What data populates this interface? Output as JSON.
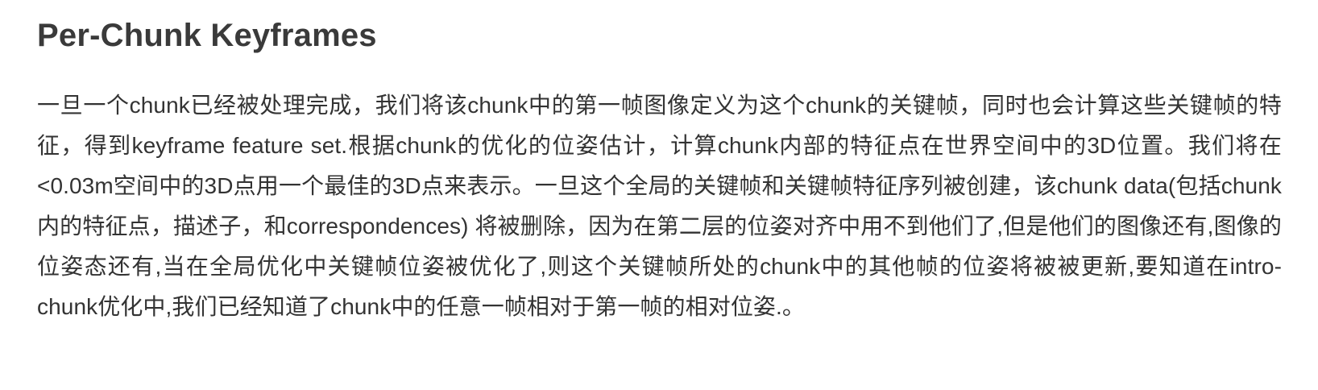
{
  "heading": "Per-Chunk Keyframes",
  "paragraph": "一旦一个chunk已经被处理完成，我们将该chunk中的第一帧图像定义为这个chunk的关键帧，同时也会计算这些关键帧的特征，得到keyframe feature set.根据chunk的优化的位姿估计，计算chunk内部的特征点在世界空间中的3D位置。我们将在<0.03m空间中的3D点用一个最佳的3D点来表示。一旦这个全局的关键帧和关键帧特征序列被创建，该chunk data(包括chunk内的特征点，描述子，和correspondences) 将被删除，因为在第二层的位姿对齐中用不到他们了,但是他们的图像还有,图像的位姿态还有,当在全局优化中关键帧位姿被优化了,则这个关键帧所处的chunk中的其他帧的位姿将被被更新,要知道在intro-chunk优化中,我们已经知道了chunk中的任意一帧相对于第一帧的相对位姿.。"
}
